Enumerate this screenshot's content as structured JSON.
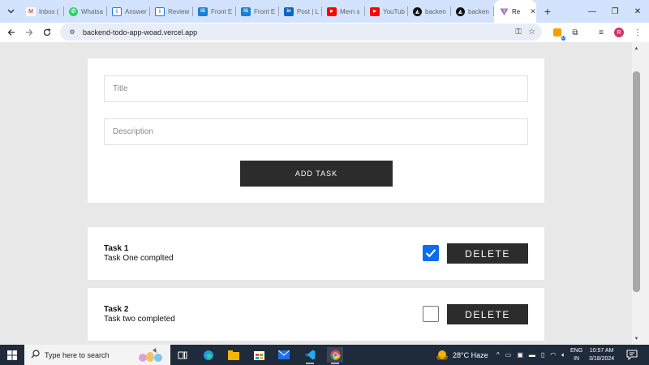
{
  "browser": {
    "tabs": [
      {
        "label": "Inbox (",
        "favicon": "gmail-icon",
        "color": "#ea4335"
      },
      {
        "label": "Whatsa",
        "favicon": "whatsapp-icon",
        "color": "#25d366"
      },
      {
        "label": "Answer",
        "favicon": "answer-icon",
        "color": "#1a73e8"
      },
      {
        "label": "Review",
        "favicon": "review-icon",
        "color": "#1a73e8"
      },
      {
        "label": "Front E",
        "favicon": "is-icon",
        "color": "#1a7fd4"
      },
      {
        "label": "Front E",
        "favicon": "is-icon",
        "color": "#1a7fd4"
      },
      {
        "label": "Post | L",
        "favicon": "linkedin-icon",
        "color": "#0a66c2"
      },
      {
        "label": "Mern s",
        "favicon": "youtube-icon",
        "color": "#ff0000"
      },
      {
        "label": "YouTub",
        "favicon": "youtube-icon",
        "color": "#ff0000"
      },
      {
        "label": "backen",
        "favicon": "render-icon",
        "color": "#111111"
      },
      {
        "label": "backen",
        "favicon": "render-icon",
        "color": "#111111"
      }
    ],
    "active_tab": {
      "label": "Re",
      "favicon": "vite-icon"
    },
    "url": "backend-todo-app-woad.vercel.app",
    "profile_initial": "R",
    "ext_badge": "0"
  },
  "form": {
    "title_placeholder": "Title",
    "description_placeholder": "Description",
    "add_label": "ADD TASK"
  },
  "tasks": [
    {
      "title": "Task 1",
      "description": "Task One complted",
      "done": true,
      "delete_label": "DELETE"
    },
    {
      "title": "Task 2",
      "description": "Task two completed",
      "done": false,
      "delete_label": "DELETE"
    }
  ],
  "taskbar": {
    "search_placeholder": "Type here to search",
    "weather": "28°C  Haze",
    "lang_top": "ENG",
    "lang_bottom": "IN",
    "time": "10:57 AM",
    "date": "3/18/2024"
  },
  "colors": {
    "checkbox_checked": "#0b6cf0",
    "button_dark": "#2c2c2c",
    "tabstrip": "#d3e3fd"
  }
}
